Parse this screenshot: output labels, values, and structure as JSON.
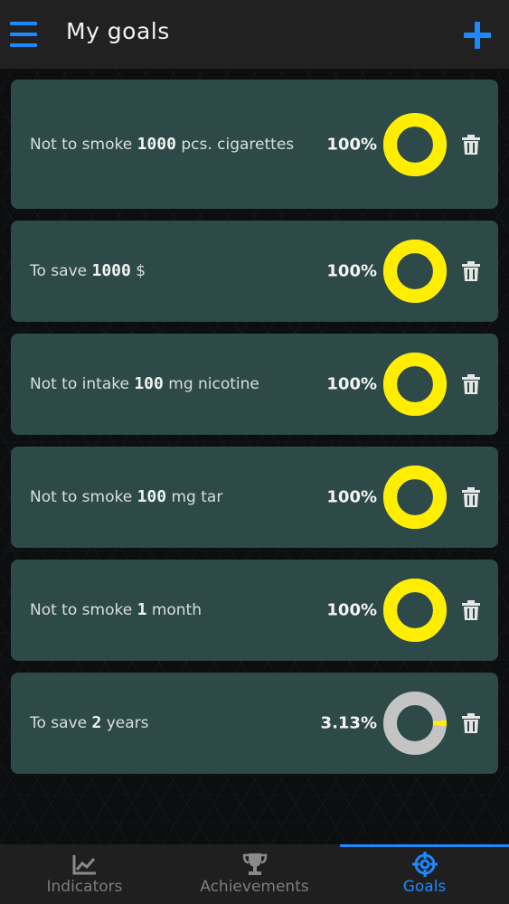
{
  "header": {
    "title": "My goals"
  },
  "colors": {
    "accent": "#1e88ff",
    "card": "#2e4a48",
    "ring_done": "#ffee00",
    "ring_empty": "#c4c4c4"
  },
  "goals": [
    {
      "pre": "Not to smoke ",
      "num": "1000",
      "post": " pcs. cigarettes",
      "percent_text": "100%",
      "progress": 1.0
    },
    {
      "pre": "To save ",
      "num": "1000",
      "post": " $",
      "percent_text": "100%",
      "progress": 1.0
    },
    {
      "pre": "Not to intake ",
      "num": "100",
      "post": " mg nicotine",
      "percent_text": "100%",
      "progress": 1.0
    },
    {
      "pre": "Not to smoke ",
      "num": "100",
      "post": " mg tar",
      "percent_text": "100%",
      "progress": 1.0
    },
    {
      "pre": "Not to smoke ",
      "num": "1",
      "post": " month",
      "percent_text": "100%",
      "progress": 1.0
    },
    {
      "pre": "To save ",
      "num": "2",
      "post": " years",
      "percent_text": "3.13%",
      "progress": 0.0313
    }
  ],
  "tabs": [
    {
      "label": "Indicators",
      "icon": "chart-icon",
      "active": false
    },
    {
      "label": "Achievements",
      "icon": "trophy-icon",
      "active": false
    },
    {
      "label": "Goals",
      "icon": "target-icon",
      "active": true
    }
  ]
}
